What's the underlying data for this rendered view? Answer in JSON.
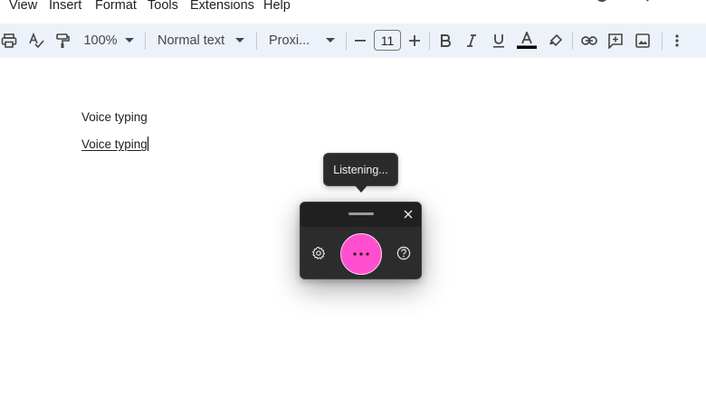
{
  "menubar": {
    "items": [
      {
        "label": "View"
      },
      {
        "label": "Insert"
      },
      {
        "label": "Format"
      },
      {
        "label": "Tools"
      },
      {
        "label": "Extensions"
      },
      {
        "label": "Help"
      }
    ]
  },
  "toolbar": {
    "zoom": "100%",
    "style": "Normal text",
    "font": "Proxi...",
    "font_size": "11",
    "icons": [
      "print-icon",
      "spellcheck-icon",
      "paint-format-icon",
      "bold-icon",
      "italic-icon",
      "underline-icon",
      "text-color-icon",
      "highlight-icon",
      "link-icon",
      "add-comment-icon",
      "insert-image-icon",
      "more-vert-icon"
    ],
    "text_color_bar": "#000000"
  },
  "document": {
    "line1": "Voice typing",
    "line2": "Voice typing"
  },
  "voice_widget": {
    "tooltip": "Listening...",
    "mic_color": "#ff4fcf",
    "icons": [
      "drag-handle",
      "close-icon",
      "settings-icon",
      "more-dots-icon",
      "help-icon"
    ]
  }
}
